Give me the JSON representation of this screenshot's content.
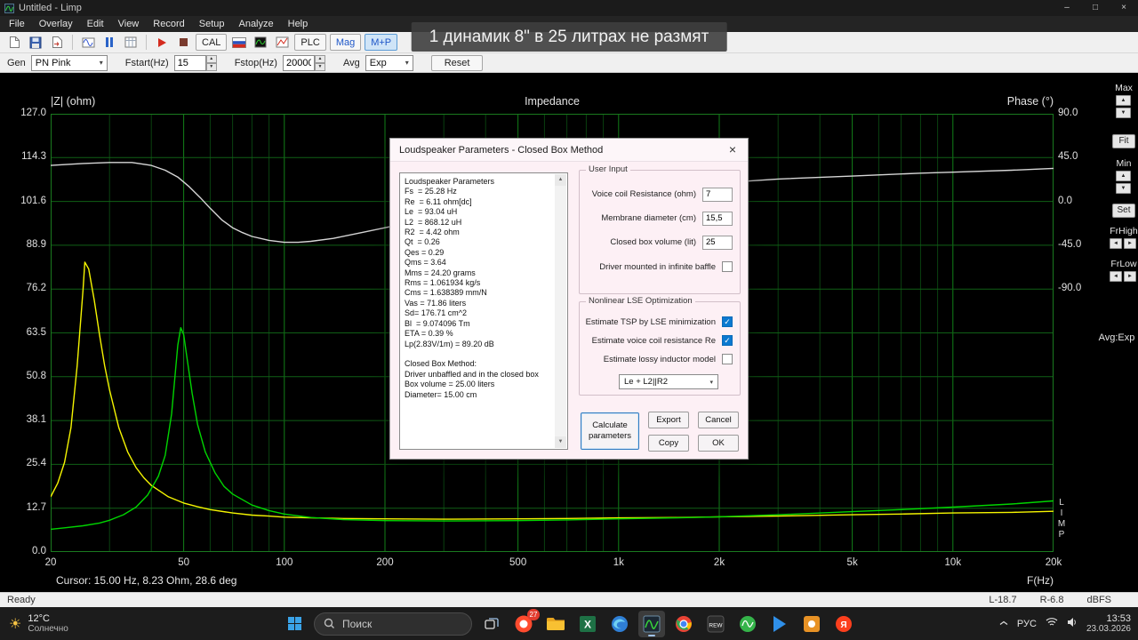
{
  "window": {
    "title": "Untitled - Limp"
  },
  "menu": [
    "File",
    "Overlay",
    "Edit",
    "View",
    "Record",
    "Setup",
    "Analyze",
    "Help"
  ],
  "toolbar": {
    "items": [
      {
        "icon": "new-file-icon"
      },
      {
        "icon": "save-icon"
      },
      {
        "icon": "export-icon"
      },
      {
        "sep": true
      },
      {
        "icon": "generator-icon"
      },
      {
        "icon": "pause-icon"
      },
      {
        "icon": "table-icon"
      },
      {
        "sep": true
      },
      {
        "icon": "record-icon"
      },
      {
        "icon": "stop-icon"
      },
      {
        "button": "CAL",
        "name": "cal-button"
      },
      {
        "icon": "ru-flag-icon"
      },
      {
        "icon": "scope-icon"
      },
      {
        "icon": "fr-icon"
      },
      {
        "button": "PLC",
        "name": "plc-button"
      },
      {
        "button": "Mag",
        "name": "mag-button",
        "accent": true
      },
      {
        "button": "M+P",
        "name": "mp-button",
        "accent": true,
        "active": true
      }
    ]
  },
  "toolbar2": {
    "gen_label": "Gen",
    "gen_value": "PN Pink",
    "fstart_label": "Fstart(Hz)",
    "fstart_value": "15",
    "fstop_label": "Fstop(Hz)",
    "fstop_value": "20000",
    "avg_label": "Avg",
    "avg_value": "Exp",
    "reset_label": "Reset"
  },
  "caption": "1 динамик 8\" в 25 литрах не размят",
  "chart": {
    "cursor_readout": "Cursor: 15.00 Hz, 8.23 Ohm, 28.6 deg",
    "limp_vertical": [
      "L",
      "I",
      "M",
      "P"
    ]
  },
  "chart_data": {
    "type": "line",
    "title": "Impedance",
    "x_axis": {
      "label": "F(Hz)",
      "scale": "log",
      "min": 20,
      "max": 20000,
      "ticks": [
        [
          20,
          "20"
        ],
        [
          50,
          "50"
        ],
        [
          100,
          "100"
        ],
        [
          200,
          "200"
        ],
        [
          500,
          "500"
        ],
        [
          1000,
          "1k"
        ],
        [
          2000,
          "2k"
        ],
        [
          5000,
          "5k"
        ],
        [
          10000,
          "10k"
        ],
        [
          20000,
          "20k"
        ]
      ]
    },
    "y_axis_left": {
      "label": "|Z| (ohm)",
      "min": 0,
      "max": 127,
      "ticks": [
        [
          127,
          "127.0"
        ],
        [
          114.3,
          "114.3"
        ],
        [
          101.6,
          "101.6"
        ],
        [
          88.9,
          "88.9"
        ],
        [
          76.2,
          "76.2"
        ],
        [
          63.5,
          "63.5"
        ],
        [
          50.8,
          "50.8"
        ],
        [
          38.1,
          "38.1"
        ],
        [
          25.4,
          "25.4"
        ],
        [
          12.7,
          "12.7"
        ],
        [
          0,
          "0.0"
        ]
      ]
    },
    "y_axis_right": {
      "label": "Phase (°)",
      "min": -90,
      "max": 90,
      "ticks": [
        [
          90,
          "90.0"
        ],
        [
          45,
          "45.0"
        ],
        [
          0,
          "0.0"
        ],
        [
          -45,
          "-45.0"
        ],
        [
          -90,
          "-90.0"
        ]
      ]
    },
    "grid": true,
    "series": [
      {
        "name": "phase",
        "unit": "deg",
        "color": "#d6d6d6",
        "points": [
          [
            20,
            37
          ],
          [
            25,
            39
          ],
          [
            30,
            40
          ],
          [
            35,
            40
          ],
          [
            40,
            37
          ],
          [
            44,
            32
          ],
          [
            48,
            25
          ],
          [
            52,
            15
          ],
          [
            56,
            4
          ],
          [
            60,
            -7
          ],
          [
            65,
            -19
          ],
          [
            70,
            -27
          ],
          [
            75,
            -32
          ],
          [
            80,
            -36
          ],
          [
            90,
            -40
          ],
          [
            100,
            -42
          ],
          [
            110,
            -42
          ],
          [
            120,
            -41
          ],
          [
            140,
            -38
          ],
          [
            170,
            -32
          ],
          [
            200,
            -27
          ],
          [
            250,
            -20
          ],
          [
            300,
            -15
          ],
          [
            400,
            -8
          ],
          [
            500,
            -3
          ],
          [
            700,
            3
          ],
          [
            1000,
            9
          ],
          [
            1500,
            15
          ],
          [
            2000,
            19
          ],
          [
            3000,
            23
          ],
          [
            5000,
            26
          ],
          [
            8000,
            29
          ],
          [
            10000,
            30
          ],
          [
            15000,
            32
          ],
          [
            20000,
            34
          ]
        ]
      },
      {
        "name": "impedance-free-air",
        "unit": "ohm",
        "color": "#f5f500",
        "points": [
          [
            20,
            16
          ],
          [
            21,
            20
          ],
          [
            22,
            26
          ],
          [
            23,
            36
          ],
          [
            24,
            54
          ],
          [
            25,
            76
          ],
          [
            25.3,
            84
          ],
          [
            26,
            82
          ],
          [
            27,
            73
          ],
          [
            28,
            63
          ],
          [
            29,
            54
          ],
          [
            30,
            47
          ],
          [
            32,
            36
          ],
          [
            34,
            29
          ],
          [
            36,
            24.5
          ],
          [
            38,
            21.5
          ],
          [
            40,
            19.3
          ],
          [
            45,
            16
          ],
          [
            50,
            14.2
          ],
          [
            55,
            13.1
          ],
          [
            60,
            12.3
          ],
          [
            70,
            11.3
          ],
          [
            80,
            10.7
          ],
          [
            90,
            10.4
          ],
          [
            100,
            10.1
          ],
          [
            120,
            9.9
          ],
          [
            150,
            9.7
          ],
          [
            200,
            9.6
          ],
          [
            300,
            9.5
          ],
          [
            500,
            9.6
          ],
          [
            700,
            9.7
          ],
          [
            1000,
            9.9
          ],
          [
            1500,
            10
          ],
          [
            2000,
            10.2
          ],
          [
            3000,
            10.4
          ],
          [
            5000,
            10.8
          ],
          [
            7000,
            11
          ],
          [
            10000,
            11.3
          ],
          [
            15000,
            11.5
          ],
          [
            20000,
            11.8
          ]
        ]
      },
      {
        "name": "impedance-closed-box",
        "unit": "ohm",
        "color": "#00d400",
        "points": [
          [
            20,
            6.6
          ],
          [
            22,
            7
          ],
          [
            25,
            7.6
          ],
          [
            28,
            8.4
          ],
          [
            30,
            9.2
          ],
          [
            33,
            10.8
          ],
          [
            36,
            13
          ],
          [
            39,
            16.5
          ],
          [
            42,
            22
          ],
          [
            44,
            28
          ],
          [
            46,
            40
          ],
          [
            47,
            50
          ],
          [
            48,
            60
          ],
          [
            49,
            65
          ],
          [
            50,
            63
          ],
          [
            51,
            57
          ],
          [
            53,
            46
          ],
          [
            55,
            37
          ],
          [
            58,
            29
          ],
          [
            62,
            23
          ],
          [
            66,
            19
          ],
          [
            70,
            16.8
          ],
          [
            80,
            13.6
          ],
          [
            90,
            12
          ],
          [
            100,
            11
          ],
          [
            120,
            10
          ],
          [
            150,
            9.4
          ],
          [
            200,
            9.1
          ],
          [
            300,
            9
          ],
          [
            500,
            9.1
          ],
          [
            700,
            9.3
          ],
          [
            1000,
            9.6
          ],
          [
            1500,
            9.9
          ],
          [
            2000,
            10.2
          ],
          [
            3000,
            10.8
          ],
          [
            5000,
            11.7
          ],
          [
            7000,
            12.3
          ],
          [
            10000,
            13
          ],
          [
            15000,
            13.9
          ],
          [
            20000,
            14.8
          ]
        ]
      }
    ]
  },
  "side_panel": {
    "max_label": "Max",
    "fit_label": "Fit",
    "min_label": "Min",
    "set_label": "Set",
    "frhigh_label": "FrHigh",
    "frlow_label": "FrLow",
    "avg_readout": "Avg:Exp"
  },
  "dialog": {
    "title": "Loudspeaker Parameters - Closed Box Method",
    "report_lines": [
      "Loudspeaker Parameters",
      "Fs  = 25.28 Hz",
      "Re  = 6.11 ohm[dc]",
      "Le  = 93.04 uH",
      "L2  = 868.12 uH",
      "R2  = 4.42 ohm",
      "Qt  = 0.26",
      "Qes = 0.29",
      "Qms = 3.64",
      "Mms = 24.20 grams",
      "Rms = 1.061934 kg/s",
      "Cms = 1.638389 mm/N",
      "Vas = 71.86 liters",
      "Sd= 176.71 cm^2",
      "Bl  = 9.074096 Tm",
      "ETA = 0.39 %",
      "Lp(2.83V/1m) = 89.20 dB",
      "",
      "Closed Box Method:",
      "Driver unbaffled and in the closed box",
      "Box volume = 25.00 liters",
      "Diameter= 15.00 cm"
    ],
    "user_input": {
      "group": "User Input",
      "fields": [
        {
          "label": "Voice coil Resistance (ohm)",
          "value": "7",
          "name": "voice-coil-resistance-field"
        },
        {
          "label": "Membrane diameter (cm)",
          "value": "15,5",
          "name": "membrane-diameter-field"
        },
        {
          "label": "Closed box volume (lit)",
          "value": "25",
          "name": "closed-box-volume-field"
        }
      ],
      "baffle_label": "Driver mounted in infinite baffle",
      "baffle_checked": false
    },
    "lse": {
      "group": "Nonlinear LSE Optimization",
      "checks": [
        {
          "label": "Estimate TSP by LSE minimization",
          "checked": true,
          "name": "estimate-tsp-checkbox"
        },
        {
          "label": "Estimate voice coil resistance Re",
          "checked": true,
          "name": "estimate-re-checkbox"
        },
        {
          "label": "Estimate lossy inductor model",
          "checked": false,
          "name": "estimate-lossy-inductor-checkbox"
        }
      ],
      "model_value": "Le + L2||R2"
    },
    "buttons": {
      "calculate": "Calculate parameters",
      "export": "Export",
      "cancel": "Cancel",
      "copy": "Copy",
      "ok": "OK"
    }
  },
  "statusbar": {
    "ready": "Ready",
    "meter_l": "L-18.7",
    "meter_r": "R-6.8",
    "meter_unit": "dBFS"
  },
  "taskbar": {
    "weather_temp": "12°C",
    "weather_desc": "Солнечно",
    "search_placeholder": "Поиск",
    "apps": [
      {
        "name": "task-view-icon"
      },
      {
        "name": "browser-icon",
        "badge": "27"
      },
      {
        "name": "explorer-icon"
      },
      {
        "name": "excel-icon",
        "label": "X"
      },
      {
        "name": "edge-icon"
      },
      {
        "name": "limp-taskbar-icon",
        "active": true
      },
      {
        "name": "chrome-icon"
      },
      {
        "name": "rew-icon",
        "label": "REW"
      },
      {
        "name": "arta-icon"
      },
      {
        "name": "player-icon"
      },
      {
        "name": "tools-icon"
      },
      {
        "name": "yandex-music-icon",
        "label": "Я"
      }
    ],
    "tray_lang": "РУС",
    "time": "13:53",
    "date": "23.03.2026"
  }
}
